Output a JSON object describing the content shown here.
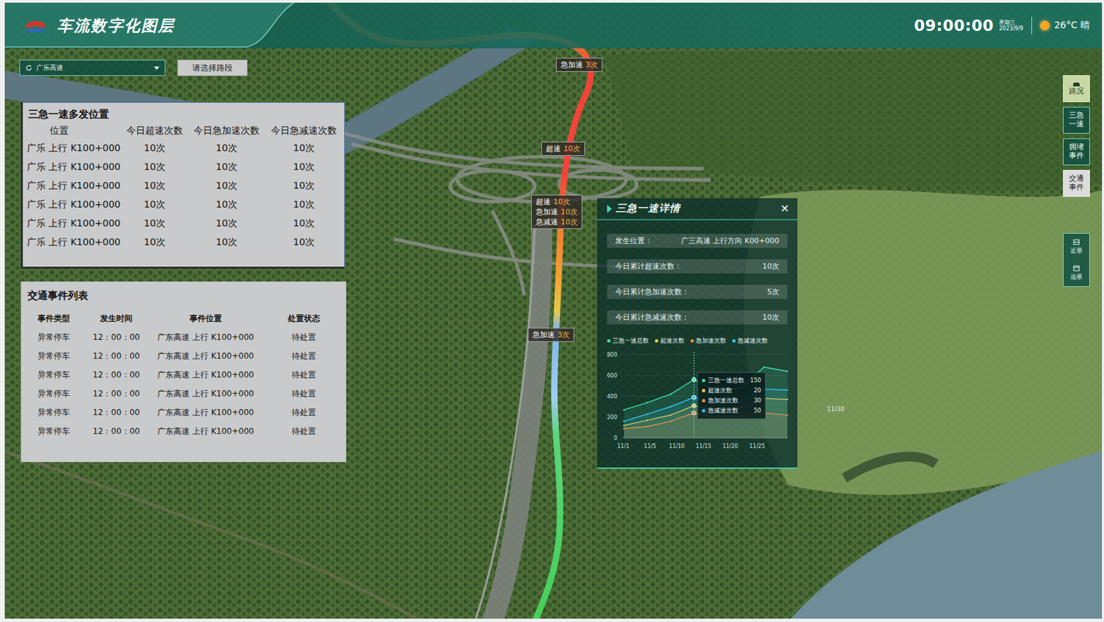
{
  "header": {
    "title": "车流数字化图层",
    "time": "09:00:00",
    "weekday": "星期三",
    "date": "2023/9/9",
    "weather": "26°C 晴"
  },
  "road_select": {
    "value": "广乐高速"
  },
  "segment_button": {
    "label": "请选择路段"
  },
  "hotspots": {
    "title": "三急一速多发位置",
    "columns": [
      "位置",
      "今日超速次数",
      "今日急加速次数",
      "今日急减速次数"
    ],
    "rows": [
      [
        "广乐 上行 K100+000",
        "10次",
        "10次",
        "10次"
      ],
      [
        "广乐 上行 K100+000",
        "10次",
        "10次",
        "10次"
      ],
      [
        "广乐 上行 K100+000",
        "10次",
        "10次",
        "10次"
      ],
      [
        "广乐 上行 K100+000",
        "10次",
        "10次",
        "10次"
      ],
      [
        "广乐 上行 K100+000",
        "10次",
        "10次",
        "10次"
      ],
      [
        "广乐 上行 K100+000",
        "10次",
        "10次",
        "10次"
      ]
    ]
  },
  "events": {
    "title": "交通事件列表",
    "columns": [
      "事件类型",
      "发生时间",
      "事件位置",
      "处置状态"
    ],
    "rows": [
      [
        "异常停车",
        "12：00：00",
        "广东高速 上行 K100+000",
        "待处置"
      ],
      [
        "异常停车",
        "12：00：00",
        "广东高速 上行 K100+000",
        "待处置"
      ],
      [
        "异常停车",
        "12：00：00",
        "广东高速 上行 K100+000",
        "待处置"
      ],
      [
        "异常停车",
        "12：00：00",
        "广东高速 上行 K100+000",
        "待处置"
      ],
      [
        "异常停车",
        "12：00：00",
        "广东高速 上行 K100+000",
        "待处置"
      ],
      [
        "异常停车",
        "12：00：00",
        "广东高速 上行 K100+000",
        "待处置"
      ]
    ]
  },
  "detail": {
    "title": "三急一速详情",
    "close": "✕",
    "fields": [
      {
        "label": "发生位置：",
        "value": "广三高速  上行方向 K00+000"
      },
      {
        "label": "今日累计超速次数：",
        "value": "10次"
      },
      {
        "label": "今日累计急加速次数：",
        "value": "5次"
      },
      {
        "label": "今日累计急减速次数：",
        "value": "10次"
      }
    ],
    "chart": {
      "series": [
        {
          "label": "三急一速总数",
          "color": "#3de0b0",
          "values": [
            270,
            340,
            420,
            560,
            450,
            480,
            680,
            640
          ]
        },
        {
          "label": "超速次数",
          "color": "#f2c94c",
          "values": [
            120,
            170,
            220,
            310,
            260,
            290,
            380,
            370
          ]
        },
        {
          "label": "急加速次数",
          "color": "#f08a3c",
          "values": [
            90,
            110,
            160,
            240,
            200,
            210,
            240,
            220
          ]
        },
        {
          "label": "急减速次数",
          "color": "#35c3f0",
          "values": [
            160,
            230,
            300,
            390,
            330,
            360,
            470,
            460
          ]
        }
      ],
      "y_ticks": [
        "800",
        "600",
        "400",
        "200",
        "0"
      ],
      "x_ticks": [
        "11/1",
        "11/5",
        "11/10",
        "11/15",
        "11/20",
        "11/25"
      ],
      "stray_tick": "11/30",
      "highlight_index": 3,
      "tooltip": [
        {
          "label": "三急一速总数",
          "value": "150"
        },
        {
          "label": "超速次数",
          "value": "20"
        },
        {
          "label": "急加速次数",
          "value": "30"
        },
        {
          "label": "急减速次数",
          "value": "50"
        }
      ]
    }
  },
  "map_labels": [
    {
      "lines": [
        {
          "label": "急加速",
          "count": "3次"
        }
      ]
    },
    {
      "lines": [
        {
          "label": "超速",
          "count": "10次"
        }
      ]
    },
    {
      "lines": [
        {
          "label": "超速",
          "count": "10次"
        },
        {
          "label": "急加速",
          "count": "10次"
        },
        {
          "label": "急减速",
          "count": "10次"
        }
      ]
    },
    {
      "lines": [
        {
          "label": "急加速",
          "count": "3次"
        }
      ]
    }
  ],
  "toolbar": {
    "items": [
      {
        "label": "路况",
        "selected": true,
        "hovered": false
      },
      {
        "label": "三急一速",
        "selected": false,
        "hovered": false
      },
      {
        "label": "拥堵事件",
        "selected": false,
        "hovered": false
      },
      {
        "label": "交通事件",
        "selected": false,
        "hovered": true
      }
    ],
    "view_items": [
      {
        "label": "近景"
      },
      {
        "label": "远景"
      }
    ]
  }
}
